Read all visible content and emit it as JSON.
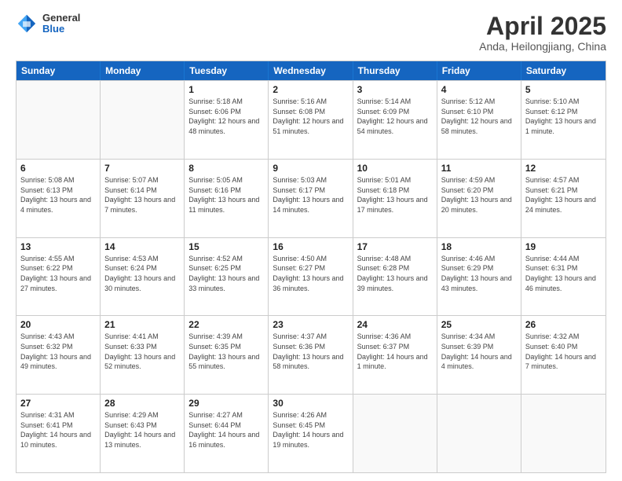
{
  "header": {
    "logo": {
      "general": "General",
      "blue": "Blue"
    },
    "title": "April 2025",
    "location": "Anda, Heilongjiang, China"
  },
  "days_of_week": [
    "Sunday",
    "Monday",
    "Tuesday",
    "Wednesday",
    "Thursday",
    "Friday",
    "Saturday"
  ],
  "weeks": [
    [
      {
        "day": "",
        "info": ""
      },
      {
        "day": "",
        "info": ""
      },
      {
        "day": "1",
        "info": "Sunrise: 5:18 AM\nSunset: 6:06 PM\nDaylight: 12 hours and 48 minutes."
      },
      {
        "day": "2",
        "info": "Sunrise: 5:16 AM\nSunset: 6:08 PM\nDaylight: 12 hours and 51 minutes."
      },
      {
        "day": "3",
        "info": "Sunrise: 5:14 AM\nSunset: 6:09 PM\nDaylight: 12 hours and 54 minutes."
      },
      {
        "day": "4",
        "info": "Sunrise: 5:12 AM\nSunset: 6:10 PM\nDaylight: 12 hours and 58 minutes."
      },
      {
        "day": "5",
        "info": "Sunrise: 5:10 AM\nSunset: 6:12 PM\nDaylight: 13 hours and 1 minute."
      }
    ],
    [
      {
        "day": "6",
        "info": "Sunrise: 5:08 AM\nSunset: 6:13 PM\nDaylight: 13 hours and 4 minutes."
      },
      {
        "day": "7",
        "info": "Sunrise: 5:07 AM\nSunset: 6:14 PM\nDaylight: 13 hours and 7 minutes."
      },
      {
        "day": "8",
        "info": "Sunrise: 5:05 AM\nSunset: 6:16 PM\nDaylight: 13 hours and 11 minutes."
      },
      {
        "day": "9",
        "info": "Sunrise: 5:03 AM\nSunset: 6:17 PM\nDaylight: 13 hours and 14 minutes."
      },
      {
        "day": "10",
        "info": "Sunrise: 5:01 AM\nSunset: 6:18 PM\nDaylight: 13 hours and 17 minutes."
      },
      {
        "day": "11",
        "info": "Sunrise: 4:59 AM\nSunset: 6:20 PM\nDaylight: 13 hours and 20 minutes."
      },
      {
        "day": "12",
        "info": "Sunrise: 4:57 AM\nSunset: 6:21 PM\nDaylight: 13 hours and 24 minutes."
      }
    ],
    [
      {
        "day": "13",
        "info": "Sunrise: 4:55 AM\nSunset: 6:22 PM\nDaylight: 13 hours and 27 minutes."
      },
      {
        "day": "14",
        "info": "Sunrise: 4:53 AM\nSunset: 6:24 PM\nDaylight: 13 hours and 30 minutes."
      },
      {
        "day": "15",
        "info": "Sunrise: 4:52 AM\nSunset: 6:25 PM\nDaylight: 13 hours and 33 minutes."
      },
      {
        "day": "16",
        "info": "Sunrise: 4:50 AM\nSunset: 6:27 PM\nDaylight: 13 hours and 36 minutes."
      },
      {
        "day": "17",
        "info": "Sunrise: 4:48 AM\nSunset: 6:28 PM\nDaylight: 13 hours and 39 minutes."
      },
      {
        "day": "18",
        "info": "Sunrise: 4:46 AM\nSunset: 6:29 PM\nDaylight: 13 hours and 43 minutes."
      },
      {
        "day": "19",
        "info": "Sunrise: 4:44 AM\nSunset: 6:31 PM\nDaylight: 13 hours and 46 minutes."
      }
    ],
    [
      {
        "day": "20",
        "info": "Sunrise: 4:43 AM\nSunset: 6:32 PM\nDaylight: 13 hours and 49 minutes."
      },
      {
        "day": "21",
        "info": "Sunrise: 4:41 AM\nSunset: 6:33 PM\nDaylight: 13 hours and 52 minutes."
      },
      {
        "day": "22",
        "info": "Sunrise: 4:39 AM\nSunset: 6:35 PM\nDaylight: 13 hours and 55 minutes."
      },
      {
        "day": "23",
        "info": "Sunrise: 4:37 AM\nSunset: 6:36 PM\nDaylight: 13 hours and 58 minutes."
      },
      {
        "day": "24",
        "info": "Sunrise: 4:36 AM\nSunset: 6:37 PM\nDaylight: 14 hours and 1 minute."
      },
      {
        "day": "25",
        "info": "Sunrise: 4:34 AM\nSunset: 6:39 PM\nDaylight: 14 hours and 4 minutes."
      },
      {
        "day": "26",
        "info": "Sunrise: 4:32 AM\nSunset: 6:40 PM\nDaylight: 14 hours and 7 minutes."
      }
    ],
    [
      {
        "day": "27",
        "info": "Sunrise: 4:31 AM\nSunset: 6:41 PM\nDaylight: 14 hours and 10 minutes."
      },
      {
        "day": "28",
        "info": "Sunrise: 4:29 AM\nSunset: 6:43 PM\nDaylight: 14 hours and 13 minutes."
      },
      {
        "day": "29",
        "info": "Sunrise: 4:27 AM\nSunset: 6:44 PM\nDaylight: 14 hours and 16 minutes."
      },
      {
        "day": "30",
        "info": "Sunrise: 4:26 AM\nSunset: 6:45 PM\nDaylight: 14 hours and 19 minutes."
      },
      {
        "day": "",
        "info": ""
      },
      {
        "day": "",
        "info": ""
      },
      {
        "day": "",
        "info": ""
      }
    ]
  ]
}
